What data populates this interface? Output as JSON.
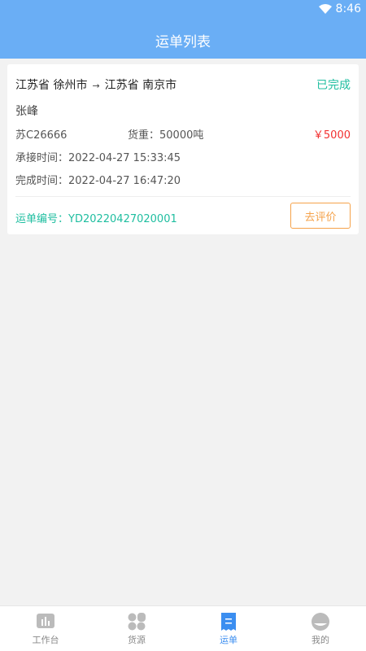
{
  "status_bar": {
    "time": "8:46"
  },
  "header": {
    "title": "运单列表"
  },
  "waybill": {
    "route_from": "江苏省 徐州市",
    "route_arrow": "→",
    "route_to": "江苏省 南京市",
    "status": "已完成",
    "driver": "张峰",
    "plate": "苏C26666",
    "weight": "货重：50000吨",
    "price": "￥5000",
    "accept_time": "承接时间：2022-04-27 15:33:45",
    "finish_time": "完成时间：2022-04-27 16:47:20",
    "order_no": "运单编号：YD20220427020001",
    "review_button": "去评价"
  },
  "tabbar": {
    "items": [
      {
        "label": "工作台",
        "icon": "workbench-icon"
      },
      {
        "label": "货源",
        "icon": "cargo-icon"
      },
      {
        "label": "运单",
        "icon": "waybill-icon",
        "active": true
      },
      {
        "label": "我的",
        "icon": "profile-icon"
      }
    ]
  },
  "colors": {
    "header": "#6aaef5",
    "status_complete": "#1fbea0",
    "price": "#f23030",
    "review": "#f5a24a",
    "tab_active": "#3b8ef0"
  }
}
